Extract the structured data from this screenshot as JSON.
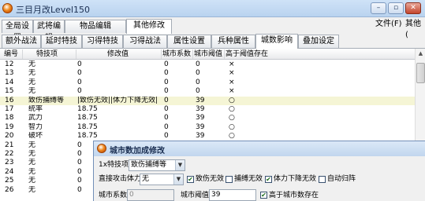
{
  "window": {
    "title": "三目月改Level150",
    "min_label": "–",
    "max_label": "▫",
    "close_label": "✕"
  },
  "menu": {
    "file": "文件(F)",
    "other": "其他("
  },
  "tabs_top": [
    "全局设置",
    "武将编辑",
    "物品编辑",
    "其他修改"
  ],
  "tabs_second": [
    "额外战法",
    "延时特技",
    "习得特技",
    "习得战法",
    "属性设置",
    "兵种属性",
    "城数影响",
    "叠加设定"
  ],
  "grid": {
    "headers": [
      "编号",
      "特技项",
      "修改值",
      "城市系数",
      "城市阈值",
      "高于阈值存在"
    ],
    "rows": [
      [
        "12",
        "无",
        "0",
        "0",
        "0",
        "×"
      ],
      [
        "13",
        "无",
        "0",
        "0",
        "0",
        "×"
      ],
      [
        "14",
        "无",
        "0",
        "0",
        "0",
        "×"
      ],
      [
        "15",
        "无",
        "0",
        "0",
        "0",
        "×"
      ],
      [
        "16",
        "致伤捕缚等",
        "|致伤无效||体力下降无效|",
        "0",
        "39",
        "○"
      ],
      [
        "17",
        "统率",
        "18.75",
        "0",
        "39",
        "○"
      ],
      [
        "18",
        "武力",
        "18.75",
        "0",
        "39",
        "○"
      ],
      [
        "19",
        "智力",
        "18.75",
        "0",
        "39",
        "○"
      ],
      [
        "20",
        "破坏",
        "18.75",
        "0",
        "39",
        "○"
      ],
      [
        "21",
        "无",
        "0",
        "",
        "",
        ""
      ],
      [
        "22",
        "无",
        "0",
        "",
        "",
        ""
      ],
      [
        "23",
        "无",
        "0",
        "",
        "",
        ""
      ],
      [
        "24",
        "无",
        "0",
        "",
        "",
        ""
      ],
      [
        "25",
        "无",
        "0",
        "",
        "",
        ""
      ],
      [
        "26",
        "无",
        "0",
        "",
        "",
        ""
      ]
    ]
  },
  "dialog": {
    "title": "城市数加成修改",
    "skill_label": "1x特技项",
    "skill_value": "致伤捕缚等",
    "attack_label": "直接攻击体力",
    "attack_value": "无",
    "checkbox_injury": "致伤无效",
    "checkbox_capture": "捕缚无效",
    "checkbox_hpdown": "体力下降无效",
    "checkbox_auto": "自动归阵",
    "coef_label": "城市系数",
    "coef_value": "0",
    "threshold_label": "城市阈值",
    "threshold_value": "39",
    "above_label": "高于城市数存在"
  }
}
